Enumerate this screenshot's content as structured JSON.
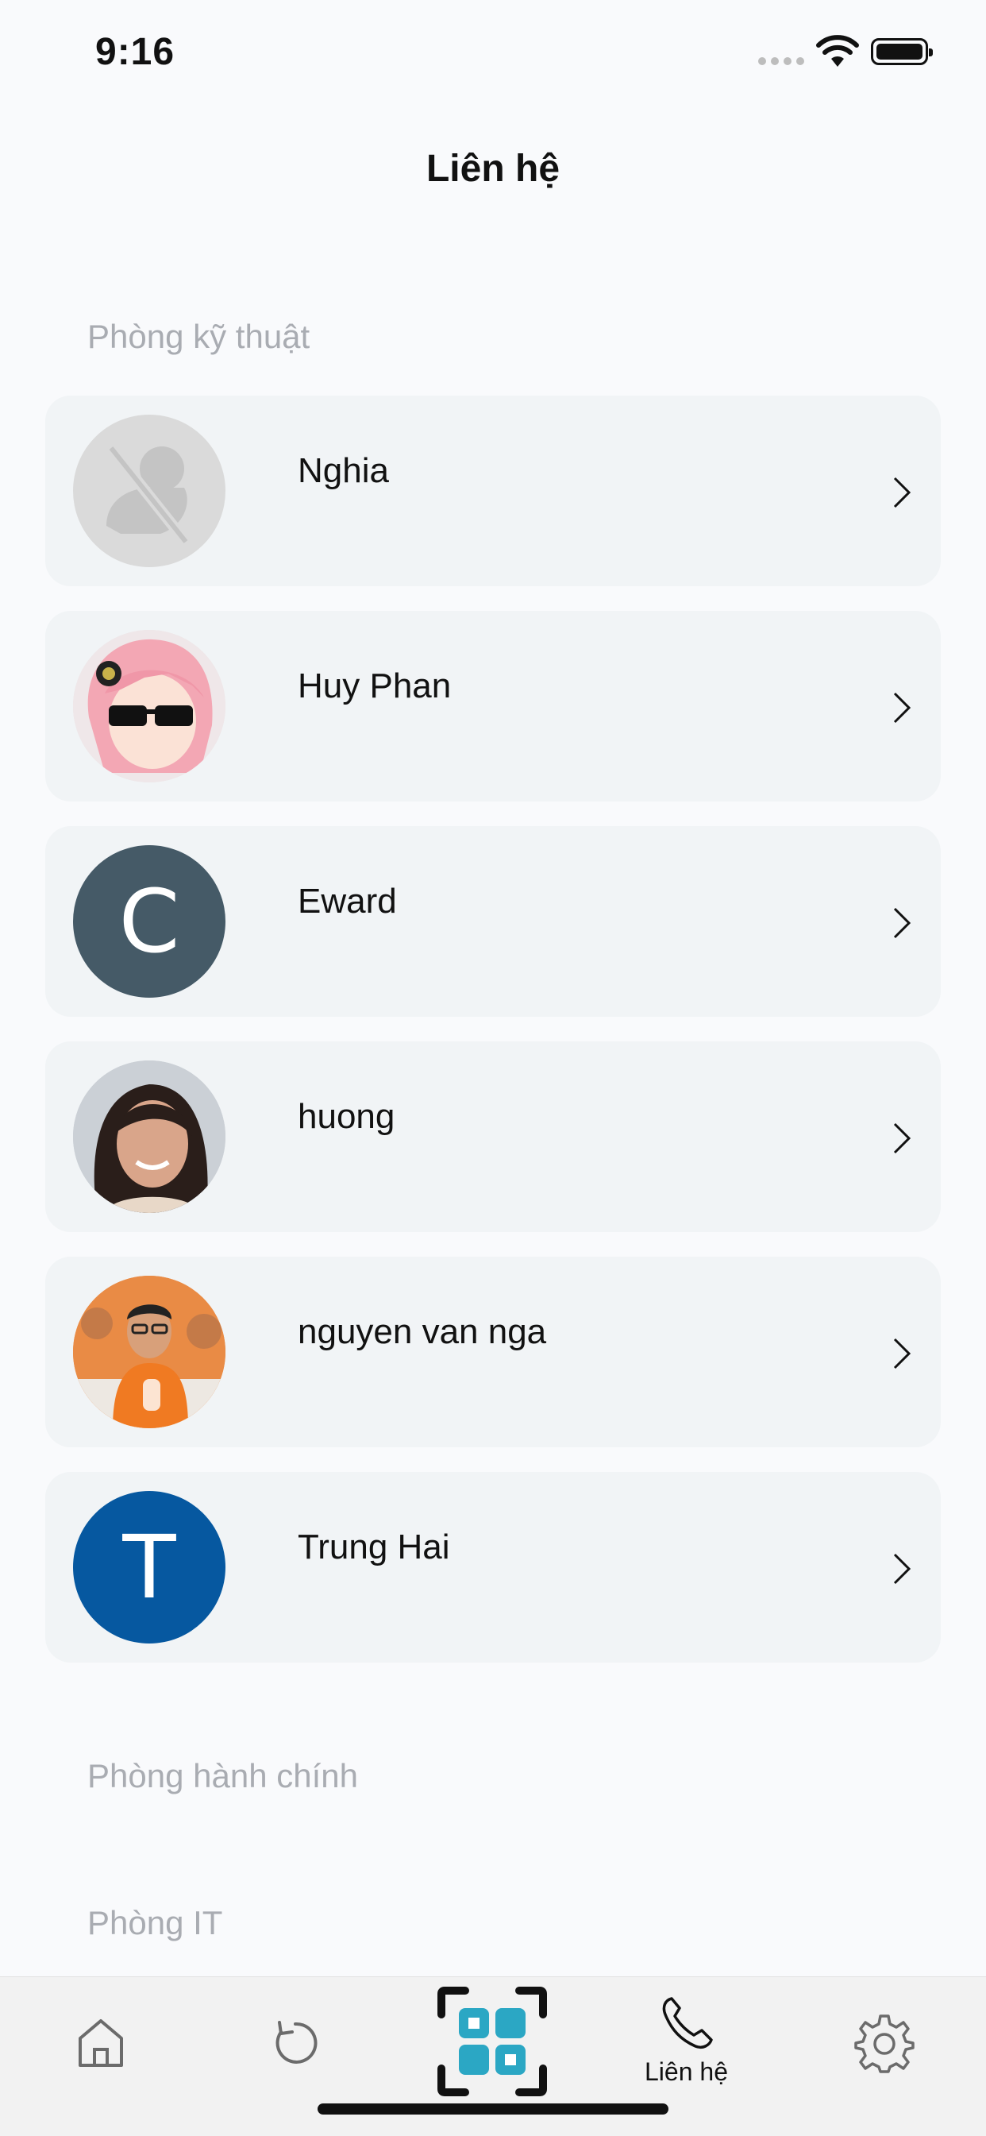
{
  "status_bar": {
    "time": "9:16"
  },
  "header": {
    "title": "Liên hệ"
  },
  "sections": [
    {
      "label": "Phòng kỹ thuật"
    },
    {
      "label": "Phòng hành chính"
    },
    {
      "label": "Phòng IT"
    }
  ],
  "contacts": [
    {
      "name": "Nghia",
      "avatar": "default-avatar"
    },
    {
      "name": "Huy Phan",
      "avatar": "photo"
    },
    {
      "name": "Eward",
      "avatar": "letter",
      "initial": "C",
      "color": "#455A67"
    },
    {
      "name": "huong",
      "avatar": "photo"
    },
    {
      "name": "nguyen van nga",
      "avatar": "photo"
    },
    {
      "name": "Trung Hai",
      "avatar": "letter",
      "initial": "T",
      "color": "#0658A0"
    }
  ],
  "tabbar": {
    "items": [
      "home-icon",
      "refresh-icon",
      "qr-scan-icon",
      "phone-icon",
      "settings-icon"
    ],
    "active_label": "Liên hệ",
    "accent": "#2BA7C4"
  }
}
